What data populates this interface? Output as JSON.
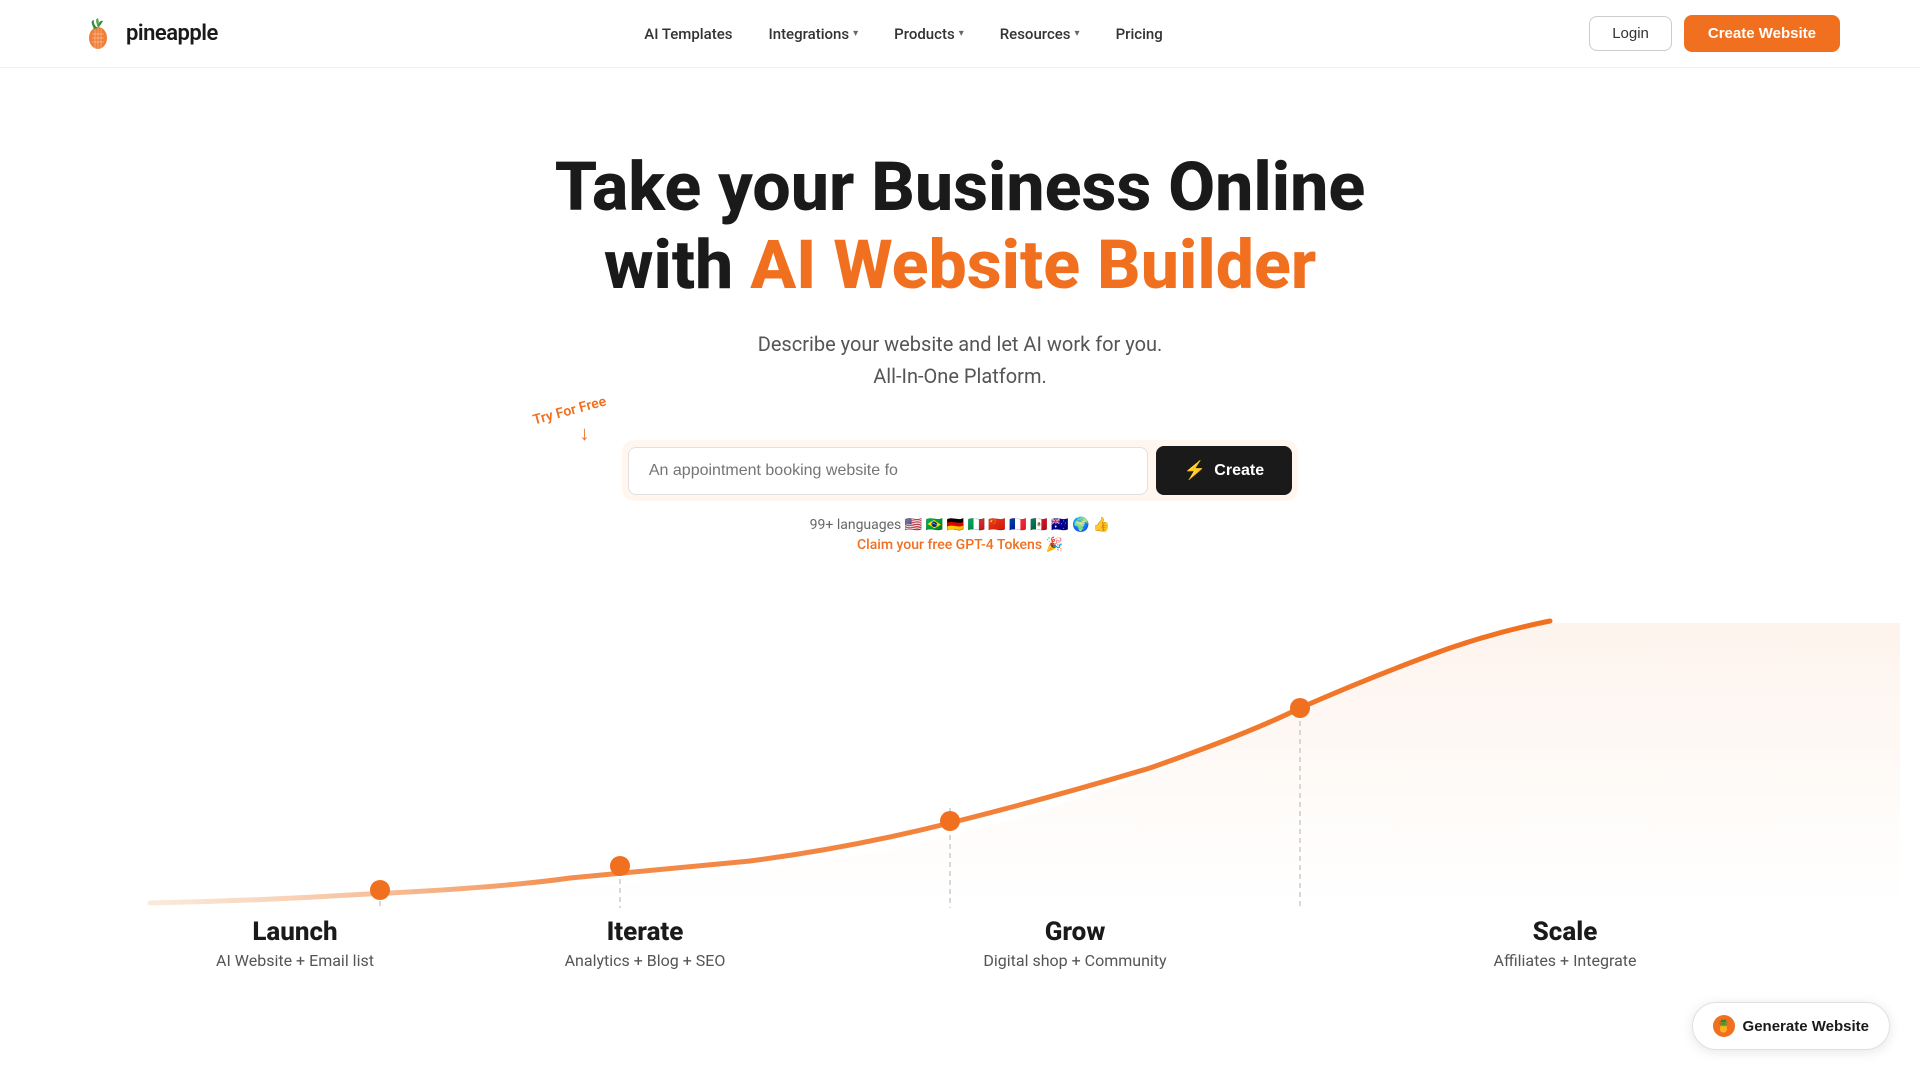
{
  "nav": {
    "logo_text": "pineapple",
    "links": [
      {
        "label": "AI Templates",
        "has_dropdown": false
      },
      {
        "label": "Integrations",
        "has_dropdown": true
      },
      {
        "label": "Products",
        "has_dropdown": true
      },
      {
        "label": "Resources",
        "has_dropdown": true
      },
      {
        "label": "Pricing",
        "has_dropdown": false
      }
    ],
    "login_label": "Login",
    "create_label": "Create Website"
  },
  "hero": {
    "title_line1": "Take your Business Online",
    "title_line2_plain": "with ",
    "title_line2_highlight": "AI Website Builder",
    "subtitle_line1": "Describe your website and let AI work for you.",
    "subtitle_line2": "All-In-One Platform.",
    "try_label": "Try For Free",
    "search_placeholder": "An appointment booking website fo",
    "create_btn_label": "Create",
    "languages_text": "99+ languages 🇺🇸 🇧🇷 🇩🇪 🇮🇹 🇨🇳 🇫🇷 🇲🇽 🇦🇺 🌍 👍",
    "claim_text": "Claim your free GPT-4 Tokens 🎉"
  },
  "chart": {
    "stages": [
      {
        "label": "Launch",
        "sub": "AI Website + Email list",
        "x_pct": 20
      },
      {
        "label": "Iterate",
        "sub": "Analytics + Blog + SEO",
        "x_pct": 39
      },
      {
        "label": "Grow",
        "sub": "Digital shop + Community",
        "x_pct": 60
      },
      {
        "label": "Scale",
        "sub": "Affiliates + Integrate",
        "x_pct": 80
      }
    ]
  },
  "floating": {
    "label": "Generate Website"
  },
  "colors": {
    "orange": "#f07020",
    "dark": "#1a1a1a",
    "light_orange_bg": "rgba(255,200,150,0.2)"
  }
}
